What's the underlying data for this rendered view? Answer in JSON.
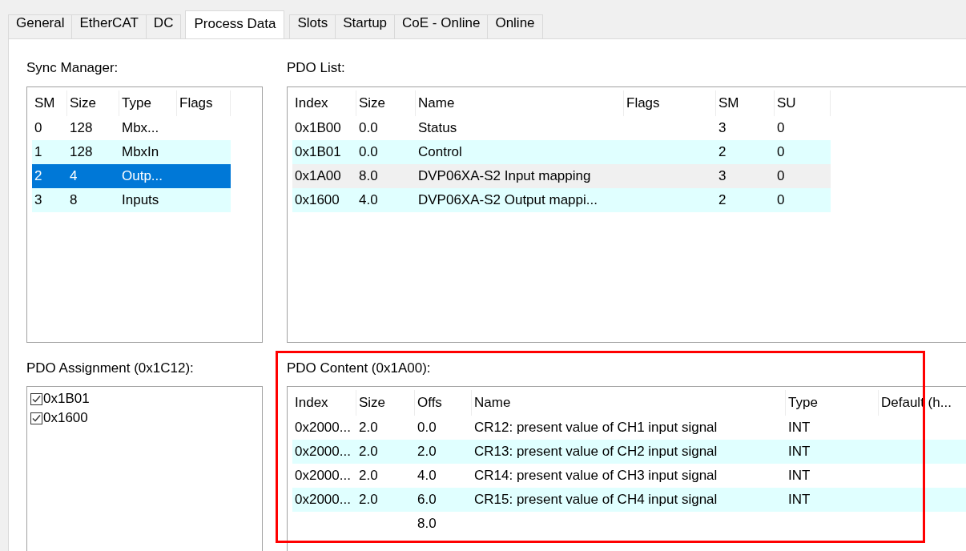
{
  "tabs": [
    {
      "label": "General",
      "selected": false
    },
    {
      "label": "EtherCAT",
      "selected": false
    },
    {
      "label": "DC",
      "selected": false
    },
    {
      "label": "Process Data",
      "selected": true
    },
    {
      "label": "Slots",
      "selected": false
    },
    {
      "label": "Startup",
      "selected": false
    },
    {
      "label": "CoE - Online",
      "selected": false
    },
    {
      "label": "Online",
      "selected": false
    }
  ],
  "sync_manager": {
    "label": "Sync Manager:",
    "focused": true,
    "columns": [
      "SM",
      "Size",
      "Type",
      "Flags"
    ],
    "rows": [
      {
        "sm": "0",
        "size": "128",
        "type": "Mbx...",
        "selected": false
      },
      {
        "sm": "1",
        "size": "128",
        "type": "MbxIn",
        "selected": false
      },
      {
        "sm": "2",
        "size": "4",
        "type": "Outp...",
        "selected": true
      },
      {
        "sm": "3",
        "size": "8",
        "type": "Inputs",
        "selected": false
      }
    ]
  },
  "pdo_list": {
    "label": "PDO List:",
    "focused": false,
    "columns": [
      "Index",
      "Size",
      "Name",
      "Flags",
      "SM",
      "SU"
    ],
    "rows": [
      {
        "index": "0x1B00",
        "size": "0.0",
        "name": "Status",
        "sm": "3",
        "su": "0",
        "selected": false
      },
      {
        "index": "0x1B01",
        "size": "0.0",
        "name": "Control",
        "sm": "2",
        "su": "0",
        "selected": false
      },
      {
        "index": "0x1A00",
        "size": "8.0",
        "name": "DVP06XA-S2 Input mapping",
        "sm": "3",
        "su": "0",
        "selected": true
      },
      {
        "index": "0x1600",
        "size": "4.0",
        "name": "DVP06XA-S2 Output mappi...",
        "sm": "2",
        "su": "0",
        "selected": false
      }
    ]
  },
  "pdo_assignment": {
    "label": "PDO Assignment (0x1C12):",
    "items": [
      {
        "label": "0x1B01",
        "checked": true
      },
      {
        "label": "0x1600",
        "checked": true
      }
    ]
  },
  "pdo_content": {
    "label": "PDO Content (0x1A00):",
    "columns": [
      "Index",
      "Size",
      "Offs",
      "Name",
      "Type",
      "Default (h..."
    ],
    "rows": [
      {
        "index": "0x2000...",
        "size": "2.0",
        "offs": "0.0",
        "name": "CR12: present value of CH1 input signal",
        "type": "INT",
        "selected": false
      },
      {
        "index": "0x2000...",
        "size": "2.0",
        "offs": "2.0",
        "name": "CR13: present value of CH2 input signal",
        "type": "INT",
        "selected": false
      },
      {
        "index": "0x2000...",
        "size": "2.0",
        "offs": "4.0",
        "name": "CR14: present value of CH3 input signal",
        "type": "INT",
        "selected": false
      },
      {
        "index": "0x2000...",
        "size": "2.0",
        "offs": "6.0",
        "name": "CR15: present value of CH4 input signal",
        "type": "INT",
        "selected": false
      },
      {
        "offs": "8.0",
        "selected": false
      }
    ]
  }
}
